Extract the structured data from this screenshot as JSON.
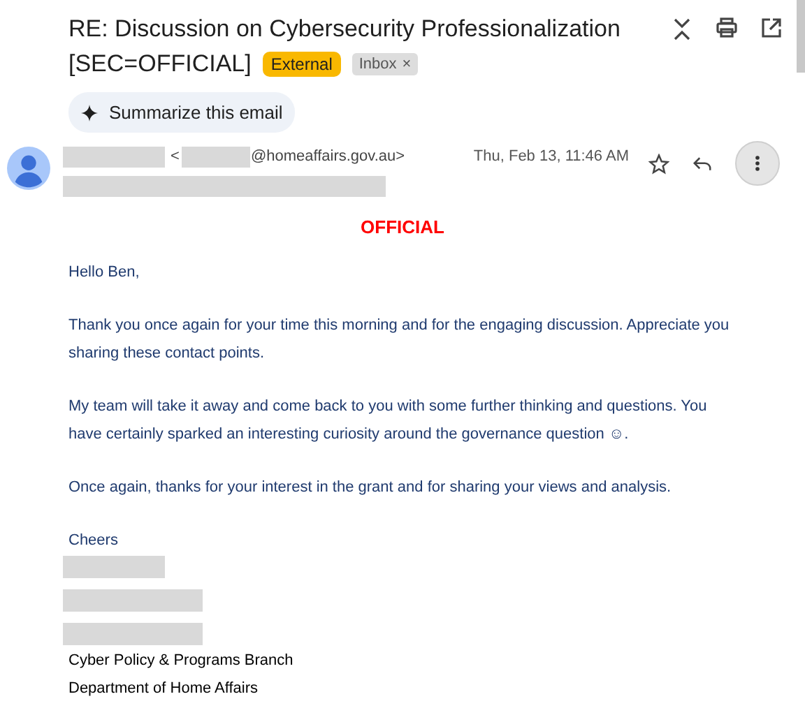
{
  "subject": {
    "title_lines": [
      "RE: Discussion on Cybersecurity Professionalization",
      "[SEC=OFFICIAL]"
    ],
    "labels": [
      {
        "kind": "external",
        "text": "External"
      },
      {
        "kind": "inbox",
        "text": "Inbox",
        "remove": "×"
      }
    ]
  },
  "summarize_button": "Summarize this email",
  "sender": {
    "open_bracket": "<",
    "email_domain": "@homeaffairs.gov.au>",
    "date": "Thu, Feb 13, 11:46 AM"
  },
  "body": {
    "classification": "OFFICIAL",
    "paragraphs": [
      "Hello Ben,",
      "Thank you once again for your time this morning and for the engaging discussion. Appreciate you sharing these contact points.",
      "My team will take it away and come back to you with some further thinking and questions. You have certainly sparked an interesting curiosity around the governance question ☺.",
      "Once again, thanks for your interest in the grant and for sharing your views and analysis."
    ],
    "signoff": "Cheers",
    "signature": [
      "Cyber Policy & Programs Branch",
      "Department of Home Affairs"
    ]
  }
}
